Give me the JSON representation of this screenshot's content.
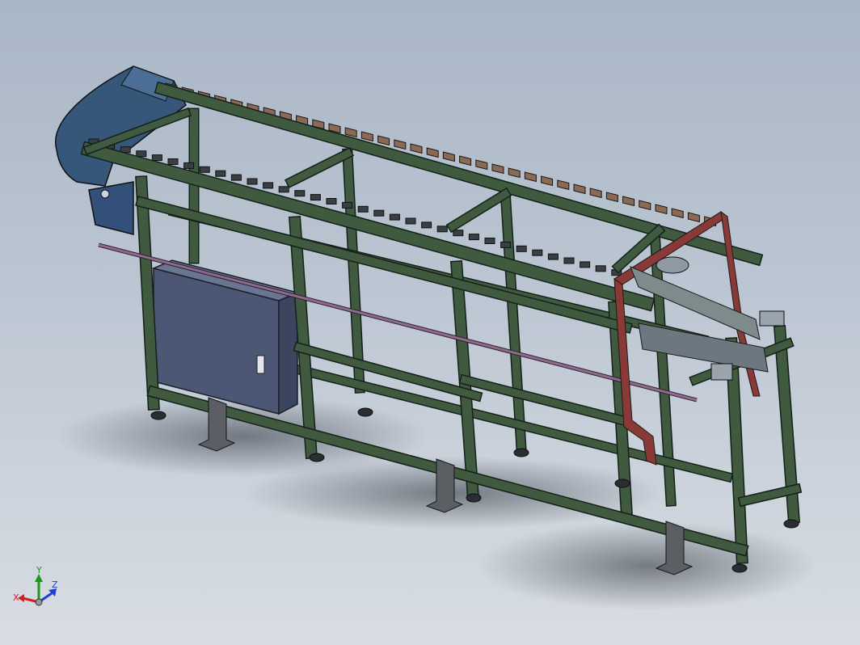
{
  "viewport": {
    "background_top": "#a9b6c6",
    "background_bottom": "#d8dde3"
  },
  "model": {
    "frame_color": "#3f5a3f",
    "frame_highlight": "#5c7a57",
    "cabinet_color": "#55607a",
    "drive_cover_color": "#3d5b7a",
    "bracket_color": "#8a3a36",
    "rod_color": "#8e6b8a",
    "slat_color": "#8a6a55"
  },
  "triad": {
    "x_label": "X",
    "y_label": "Y",
    "z_label": "Z",
    "x_color": "#d02020",
    "y_color": "#1d9a1d",
    "z_color": "#2040d0"
  }
}
